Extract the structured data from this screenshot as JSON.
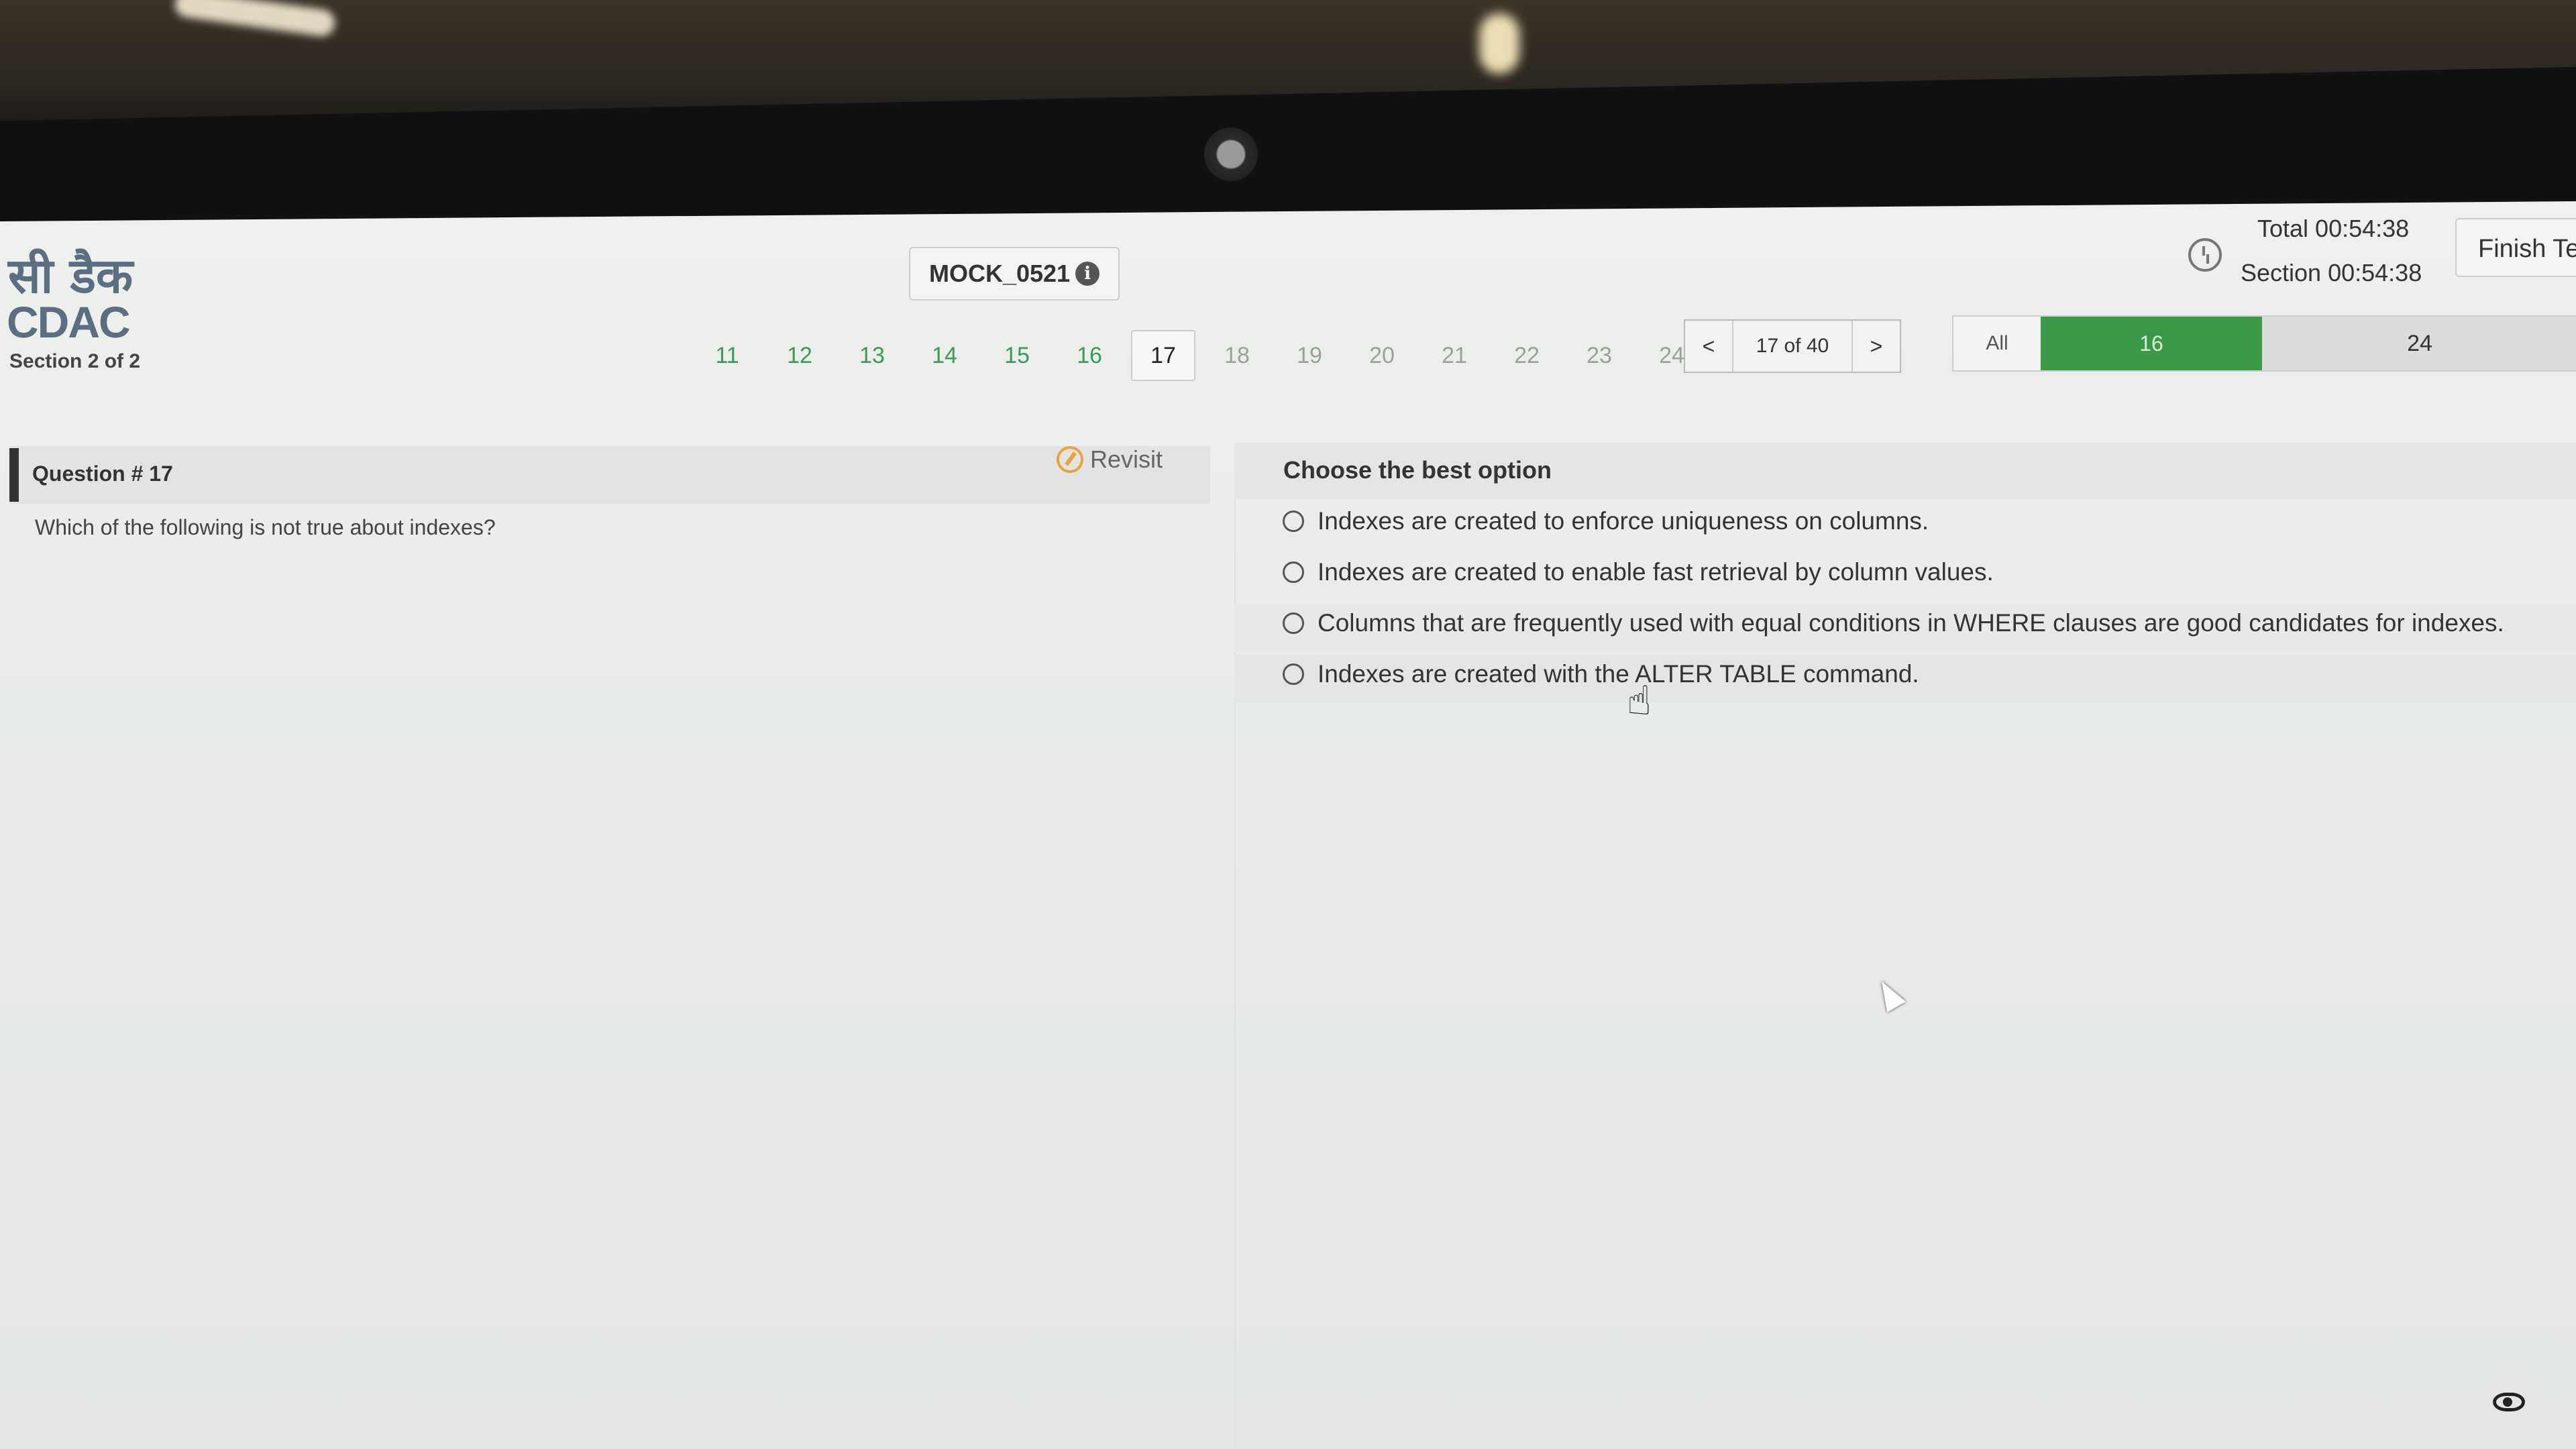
{
  "logo": {
    "hindi": "सी डैक",
    "latin": "CDAC"
  },
  "header": {
    "section": "Section 2 of 2",
    "test_name": "MOCK_0521",
    "info_icon": "info-icon",
    "timer": {
      "total": "Total 00:54:38",
      "section": "Section 00:54:38"
    },
    "finish_label": "Finish Te"
  },
  "question_nav": {
    "numbers": [
      {
        "n": "11",
        "state": "answered"
      },
      {
        "n": "12",
        "state": "answered"
      },
      {
        "n": "13",
        "state": "answered"
      },
      {
        "n": "14",
        "state": "answered"
      },
      {
        "n": "15",
        "state": "answered"
      },
      {
        "n": "16",
        "state": "answered"
      },
      {
        "n": "17",
        "state": "current"
      },
      {
        "n": "18",
        "state": "unvisited"
      },
      {
        "n": "19",
        "state": "unvisited"
      },
      {
        "n": "20",
        "state": "unvisited"
      },
      {
        "n": "21",
        "state": "unvisited"
      },
      {
        "n": "22",
        "state": "unvisited"
      },
      {
        "n": "23",
        "state": "unvisited"
      },
      {
        "n": "24",
        "state": "unvisited"
      }
    ],
    "prev_label": "<",
    "next_label": ">",
    "position": "17 of 40"
  },
  "filter": {
    "all_label": "All",
    "answered_count": "16",
    "remaining_count": "24",
    "answered_color": "#3a9a48"
  },
  "question": {
    "title": "Question # 17",
    "revisit_label": "Revisit",
    "text": "Which of the following is not true about indexes?"
  },
  "options": {
    "heading": "Choose the best option",
    "items": [
      "Indexes are created to enforce uniqueness on columns.",
      "Indexes are created to enable fast retrieval by column values.",
      "Columns that are frequently used with equal conditions in WHERE clauses are good candidates for indexes.",
      "Indexes are created with the ALTER TABLE command."
    ]
  }
}
